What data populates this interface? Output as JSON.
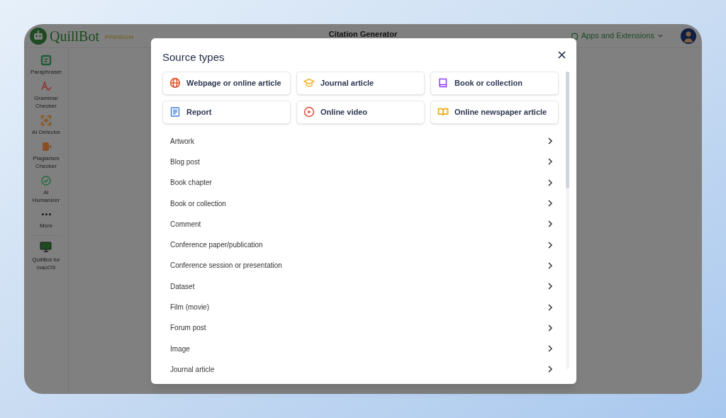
{
  "app": {
    "logo": "QuillBot",
    "plan": "PREMIUM",
    "title": "Citation Generator",
    "apps_menu": "Apps and Extensions"
  },
  "sidebar": {
    "items": [
      {
        "label": "Paraphraser",
        "kind": "paraphraser",
        "color": "#1f5a3a"
      },
      {
        "label": "Grammar Checker",
        "kind": "grammar",
        "color": "#8a3a36"
      },
      {
        "label": "AI Detector",
        "kind": "detector",
        "color": "#8a5a26"
      },
      {
        "label": "Plagiarism Checker",
        "kind": "plagiarism",
        "color": "#8a4f26"
      },
      {
        "label": "AI Humanizer",
        "kind": "humanizer",
        "color": "#1f6a3e"
      },
      {
        "label": "More",
        "kind": "more",
        "color": "#1a1a1a"
      }
    ],
    "footer": {
      "label": "QuillBot for macOS"
    }
  },
  "dialog": {
    "title": "Source types",
    "featured": [
      {
        "label": "Webpage or online article",
        "kind": "globe",
        "color": "#e0582e"
      },
      {
        "label": "Journal article",
        "kind": "cap",
        "color": "#f0b429"
      },
      {
        "label": "Book or collection",
        "kind": "book",
        "color": "#8a3ffc"
      },
      {
        "label": "Report",
        "kind": "document",
        "color": "#3b7dd8"
      },
      {
        "label": "Online video",
        "kind": "play",
        "color": "#e0442e"
      },
      {
        "label": "Online newspaper article",
        "kind": "openbook",
        "color": "#f0b429"
      }
    ],
    "list": [
      "Artwork",
      "Blog post",
      "Book chapter",
      "Book or collection",
      "Comment",
      "Conference paper/publication",
      "Conference session or presentation",
      "Dataset",
      "Film (movie)",
      "Forum post",
      "Image",
      "Journal article"
    ]
  }
}
